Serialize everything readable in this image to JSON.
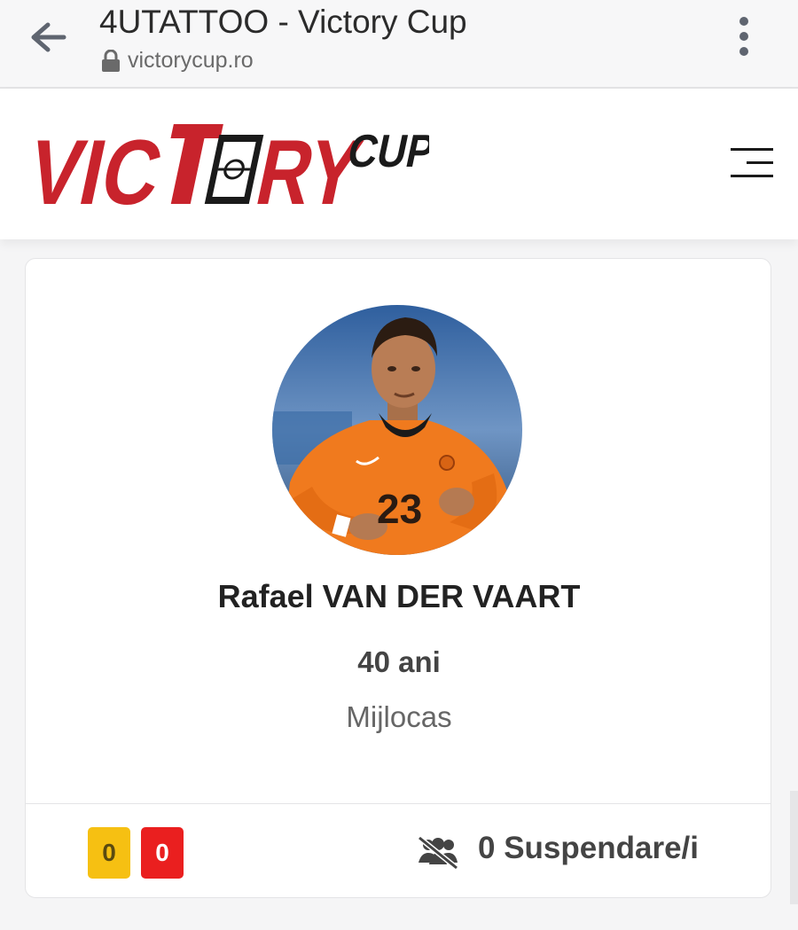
{
  "browser": {
    "page_title": "4UTATTOO - Victory Cup",
    "url": "victorycup.ro"
  },
  "header": {
    "logo_text": "VICTORY",
    "logo_sup": "CUP"
  },
  "player": {
    "name": "Rafael VAN DER VAART",
    "age": "40 ani",
    "position": "Mijlocas",
    "shirt_number": "23",
    "yellow_cards": "0",
    "red_cards": "0",
    "suspensions": "0 Suspendare/i"
  },
  "colors": {
    "brand_red": "#c8232c",
    "yellow_card": "#f6c012",
    "red_card": "#ea1f1f",
    "jersey_orange": "#f07a1e"
  },
  "icons": {
    "back": "arrow-left-icon",
    "lock": "lock-icon",
    "more": "kebab-icon",
    "menu": "hamburger-icon",
    "suspension": "users-slash-icon"
  }
}
